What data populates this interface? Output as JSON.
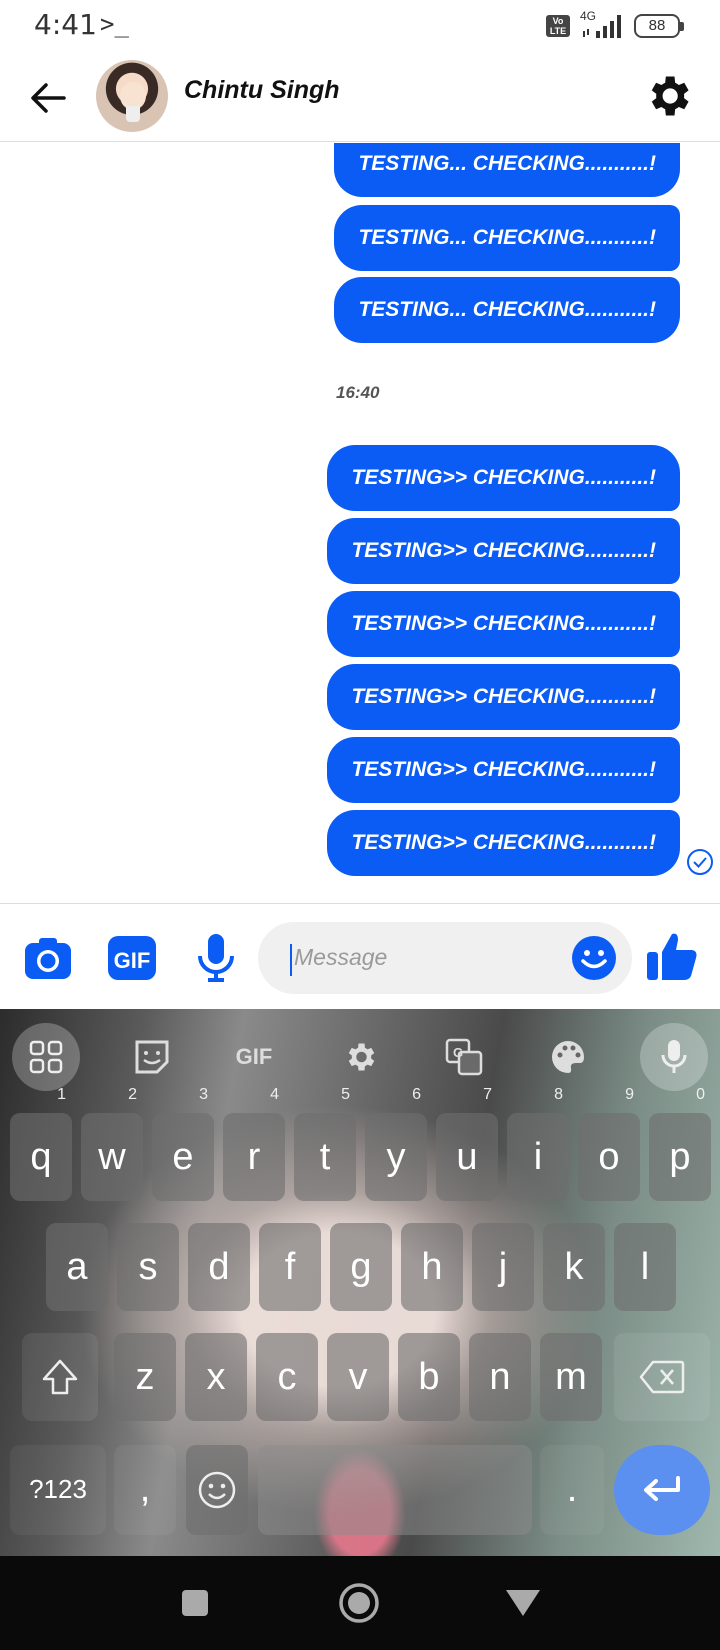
{
  "status_bar": {
    "time": "4:41",
    "terminal_glyph": ">_",
    "network": "4G",
    "volte": "Vo LTE",
    "battery": "88"
  },
  "header": {
    "contact_name": "Chintu Singh",
    "back_icon": "arrow-left-icon",
    "settings_icon": "gear-icon"
  },
  "messages": {
    "group_1": [
      "TESTING... CHECKING...........!",
      "TESTING... CHECKING...........!",
      "TESTING... CHECKING...........!"
    ],
    "timestamp": "16:40",
    "group_2": [
      "TESTING>> CHECKING...........!",
      "TESTING>> CHECKING...........!",
      "TESTING>> CHECKING...........!",
      "TESTING>> CHECKING...........!",
      "TESTING>> CHECKING...........!",
      "TESTING>> CHECKING...........!"
    ]
  },
  "composer": {
    "placeholder": "Message",
    "gif_label": "GIF"
  },
  "keyboard": {
    "toolbar": {
      "gif_label": "GIF"
    },
    "row1": [
      {
        "k": "q",
        "n": "1"
      },
      {
        "k": "w",
        "n": "2"
      },
      {
        "k": "e",
        "n": "3"
      },
      {
        "k": "r",
        "n": "4"
      },
      {
        "k": "t",
        "n": "5"
      },
      {
        "k": "y",
        "n": "6"
      },
      {
        "k": "u",
        "n": "7"
      },
      {
        "k": "i",
        "n": "8"
      },
      {
        "k": "o",
        "n": "9"
      },
      {
        "k": "p",
        "n": "0"
      }
    ],
    "row2": [
      "a",
      "s",
      "d",
      "f",
      "g",
      "h",
      "j",
      "k",
      "l"
    ],
    "row3": [
      "z",
      "x",
      "c",
      "v",
      "b",
      "n",
      "m"
    ],
    "symbols_label": "?123",
    "comma": ",",
    "period": "."
  },
  "colors": {
    "accent": "#0b5cf5",
    "enter_key": "#5b8ff0"
  }
}
